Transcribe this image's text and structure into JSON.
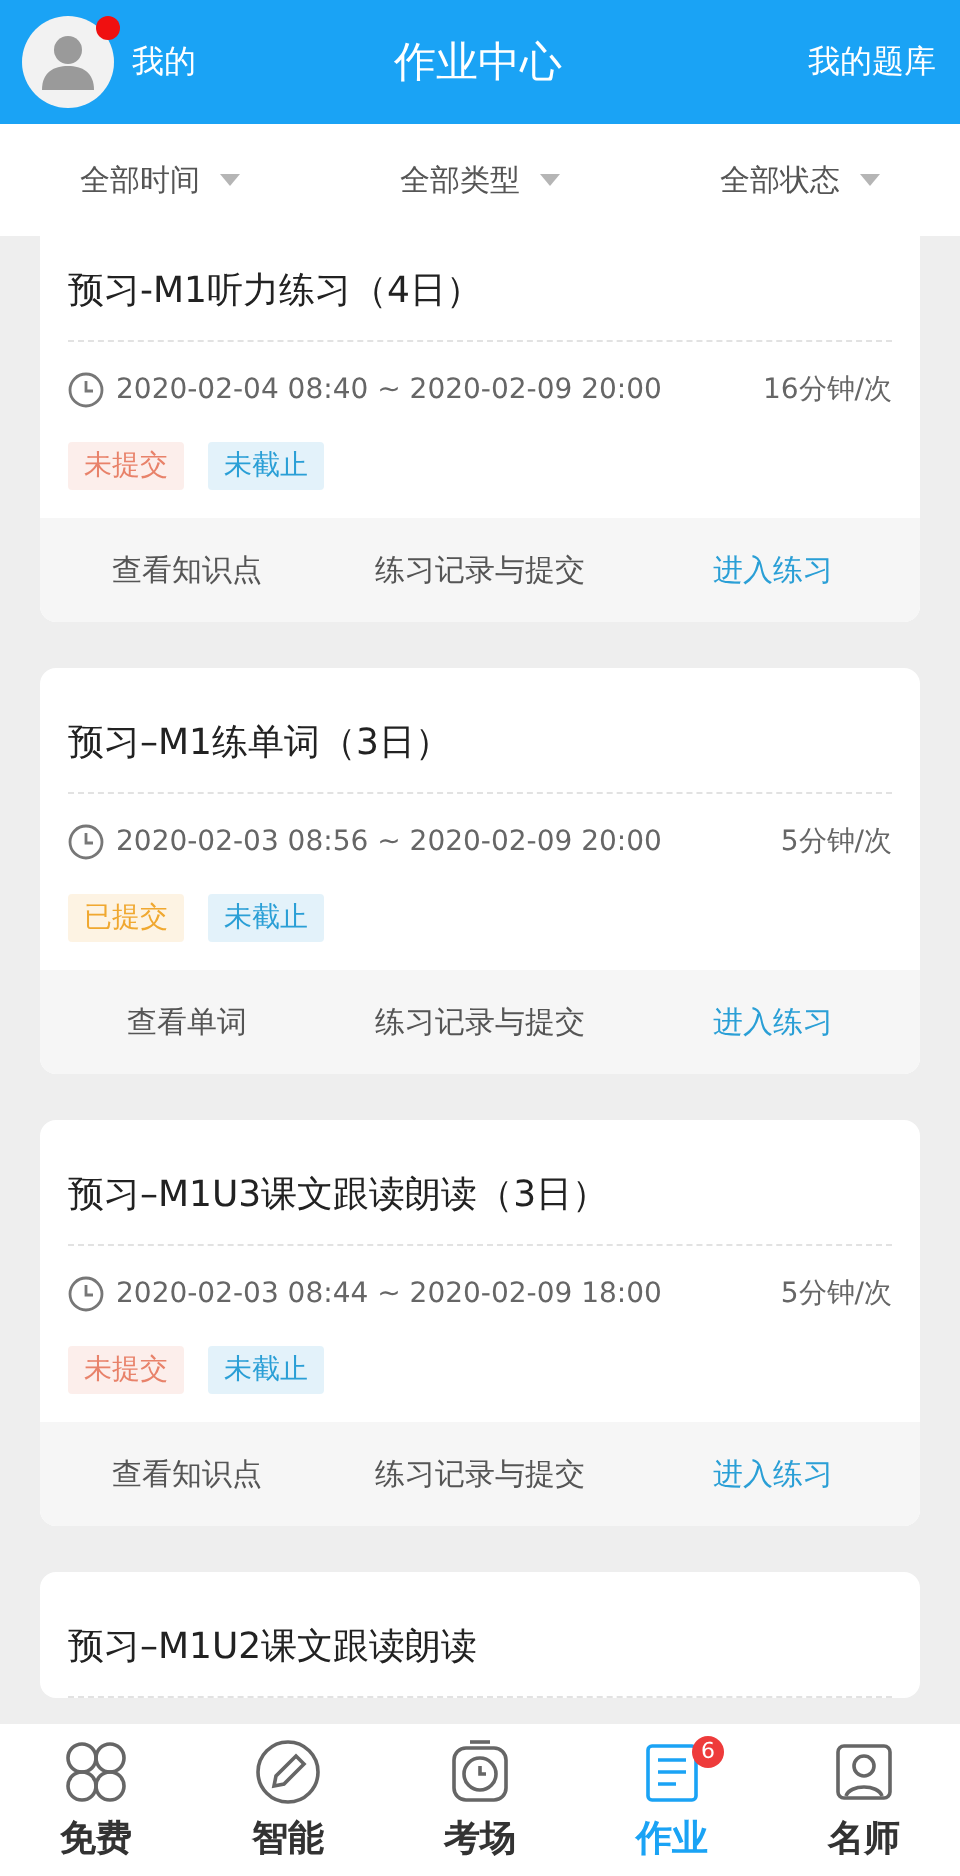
{
  "header": {
    "left_label": "我的",
    "title": "作业中心",
    "right_label": "我的题库",
    "has_notification": true
  },
  "filters": [
    {
      "label": "全部时间"
    },
    {
      "label": "全部类型"
    },
    {
      "label": "全部状态"
    }
  ],
  "assignments": [
    {
      "title": "预习-M1听力练习（4日）",
      "time": "2020-02-04 08:40 ~ 2020-02-09 20:00",
      "duration": "16分钟/次",
      "tags": [
        {
          "text": "未提交",
          "color": "#e8826a"
        },
        {
          "text": "未截止",
          "color": "#2a9fd6"
        }
      ],
      "actions": [
        {
          "label": "查看知识点",
          "primary": false
        },
        {
          "label": "练习记录与提交",
          "primary": false
        },
        {
          "label": "进入练习",
          "primary": true
        }
      ]
    },
    {
      "title": "预习–M1练单词（3日）",
      "time": "2020-02-03 08:56 ~ 2020-02-09 20:00",
      "duration": "5分钟/次",
      "tags": [
        {
          "text": "已提交",
          "color": "#f0a830"
        },
        {
          "text": "未截止",
          "color": "#2a9fd6"
        }
      ],
      "actions": [
        {
          "label": "查看单词",
          "primary": false
        },
        {
          "label": "练习记录与提交",
          "primary": false
        },
        {
          "label": "进入练习",
          "primary": true
        }
      ]
    },
    {
      "title": "预习–M1U3课文跟读朗读（3日）",
      "time": "2020-02-03 08:44 ~ 2020-02-09 18:00",
      "duration": "5分钟/次",
      "tags": [
        {
          "text": "未提交",
          "color": "#e8826a"
        },
        {
          "text": "未截止",
          "color": "#2a9fd6"
        }
      ],
      "actions": [
        {
          "label": "查看知识点",
          "primary": false
        },
        {
          "label": "练习记录与提交",
          "primary": false
        },
        {
          "label": "进入练习",
          "primary": true
        }
      ]
    },
    {
      "title": "预习–M1U2课文跟读朗读"
    }
  ],
  "nav": [
    {
      "label": "免费",
      "kind": "petals",
      "selected": false
    },
    {
      "label": "智能",
      "kind": "pencil",
      "selected": false
    },
    {
      "label": "考场",
      "kind": "clock",
      "selected": false
    },
    {
      "label": "作业",
      "kind": "book",
      "selected": true,
      "badge": "6"
    },
    {
      "label": "名师",
      "kind": "teacher",
      "selected": false
    }
  ]
}
